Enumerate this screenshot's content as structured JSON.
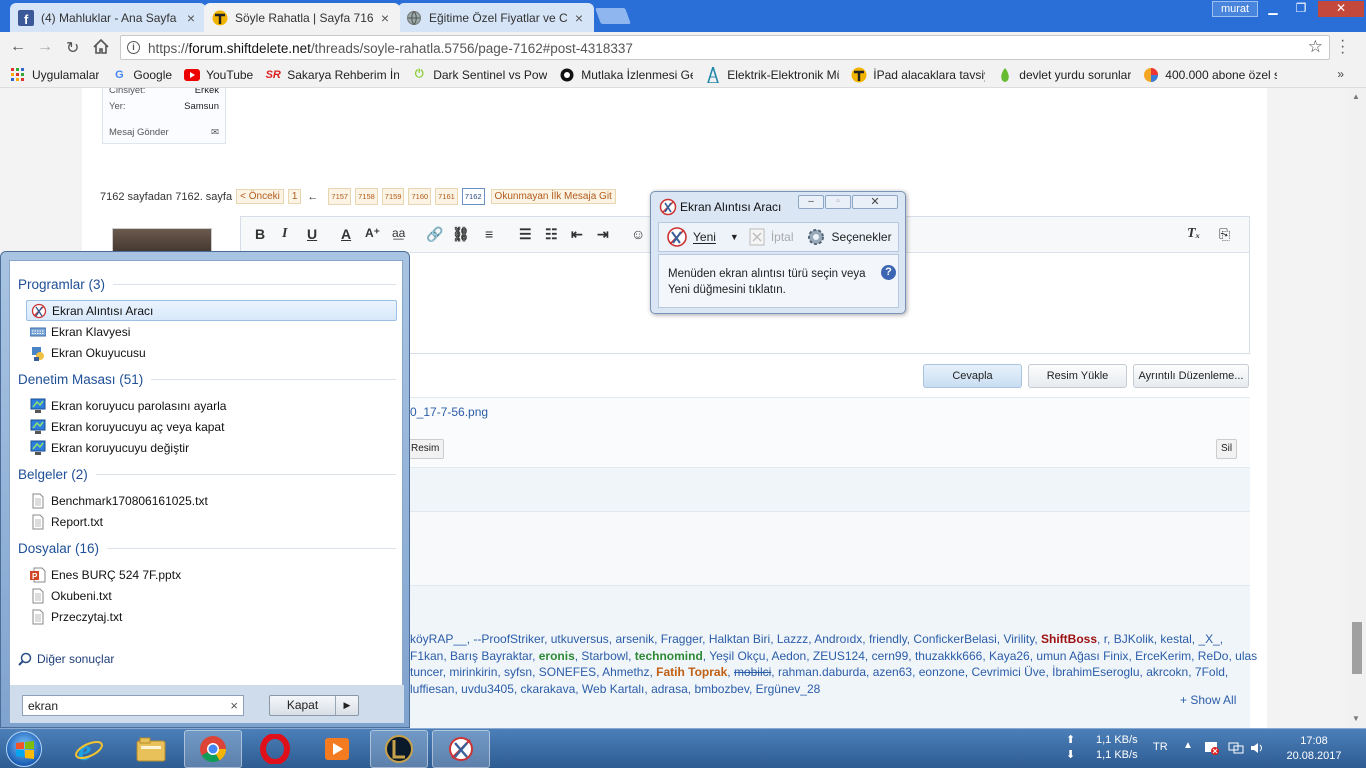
{
  "browser": {
    "tabs": [
      {
        "title": "(4) Mahluklar - Ana Sayfa",
        "icon": "facebook-icon",
        "color": "#3b5998"
      },
      {
        "title": "Söyle Rahatla | Sayfa 716",
        "icon": "shiftdelete-icon",
        "color": "#f0b400"
      },
      {
        "title": "Eğitime Özel Fiyatlar ve C",
        "icon": "globe-icon",
        "color": "#888888"
      }
    ],
    "user": "murat",
    "url_prefix": "https://",
    "url_host": "forum.shiftdelete.net",
    "url_path": "/threads/soyle-rahatla.5756/page-7162#post-4318337"
  },
  "bookmarks": [
    {
      "label": "Uygulamalar",
      "icon": "apps-grid-icon"
    },
    {
      "label": "Google",
      "icon": "google-icon"
    },
    {
      "label": "YouTube",
      "icon": "youtube-icon"
    },
    {
      "label": "Sakarya Rehberim İnç",
      "icon": "sr-logo-icon"
    },
    {
      "label": "Dark Sentinel vs Pow",
      "icon": "power-icon"
    },
    {
      "label": "Mutlaka İzlenmesi Ge",
      "icon": "chat-bubble-icon"
    },
    {
      "label": "Elektrik-Elektronik Mü",
      "icon": "tower-icon"
    },
    {
      "label": "İPad alacaklara tavsiy",
      "icon": "shiftdelete-icon"
    },
    {
      "label": "devlet yurdu sorunlar",
      "icon": "leaf-icon"
    },
    {
      "label": "400.000 abone özel s",
      "icon": "pie-icon"
    }
  ],
  "forum": {
    "userinfo": {
      "gender_label": "Cinsiyet:",
      "gender_value": "Erkek",
      "location_label": "Yer:",
      "location_value": "Samsun",
      "message": "Mesaj Gönder"
    },
    "pager": {
      "summary": "7162 sayfadan 7162. sayfa",
      "prev": "< Önceki",
      "first": "1",
      "dots": "←",
      "pages": [
        "7157",
        "7158",
        "7159",
        "7160",
        "7161"
      ],
      "current": "7162",
      "unread": "Okunmayan İlk Mesaja Git"
    },
    "buttons": {
      "reply": "Cevapla",
      "upload": "Resim Yükle",
      "advanced": "Ayrıntılı Düzenleme..."
    },
    "attachment": {
      "name": "0_17-7-56.png",
      "image_btn": "Resim",
      "delete_btn": "Sil"
    },
    "online_users": [
      {
        "n": "köyRAP__",
        "s": ""
      },
      {
        "n": "--ProofStriker",
        "s": ""
      },
      {
        "n": "utkuversus",
        "s": ""
      },
      {
        "n": "arsenik",
        "s": ""
      },
      {
        "n": "Fragger",
        "s": ""
      },
      {
        "n": "Halktan Biri",
        "s": ""
      },
      {
        "n": "Lazzz",
        "s": ""
      },
      {
        "n": "Androıdx",
        "s": ""
      },
      {
        "n": "friendly",
        "s": ""
      },
      {
        "n": "ConfickerBelasi",
        "s": ""
      },
      {
        "n": "Virility",
        "s": ""
      },
      {
        "n": "ShiftBoss",
        "s": "r"
      },
      {
        "n": "r",
        "s": ""
      },
      {
        "n": "BJKolik",
        "s": ""
      },
      {
        "n": "kestal",
        "s": ""
      },
      {
        "n": "_X_",
        "s": ""
      },
      {
        "n": "F1kan",
        "s": ""
      },
      {
        "n": "Barış Bayraktar",
        "s": ""
      },
      {
        "n": "eronis",
        "s": "g"
      },
      {
        "n": "Starbowl",
        "s": ""
      },
      {
        "n": "technomind",
        "s": "g"
      },
      {
        "n": "Yeşil Okçu",
        "s": ""
      },
      {
        "n": "Aedon",
        "s": ""
      },
      {
        "n": "ZEUS124",
        "s": ""
      },
      {
        "n": "cern99",
        "s": ""
      },
      {
        "n": "thuzakkk666",
        "s": ""
      },
      {
        "n": "Kaya26",
        "s": ""
      },
      {
        "n": "umun Ağası Finix",
        "s": ""
      },
      {
        "n": "ErceKerim",
        "s": ""
      },
      {
        "n": "ReDo",
        "s": ""
      },
      {
        "n": "ulas tuncer",
        "s": ""
      },
      {
        "n": "mirinkirin",
        "s": ""
      },
      {
        "n": "syfsn",
        "s": ""
      },
      {
        "n": "SONEFES",
        "s": ""
      },
      {
        "n": "Ahmethz",
        "s": ""
      },
      {
        "n": "Fatih Toprak",
        "s": "o"
      },
      {
        "n": "mobilci",
        "s": "x"
      },
      {
        "n": "rahman.daburda",
        "s": ""
      },
      {
        "n": "azen63",
        "s": ""
      },
      {
        "n": "eonzone",
        "s": ""
      },
      {
        "n": "Cevrimici Üve",
        "s": ""
      },
      {
        "n": "İbrahimEseroglu",
        "s": ""
      },
      {
        "n": "akrcokn",
        "s": ""
      },
      {
        "n": "7Fold",
        "s": ""
      },
      {
        "n": "luffiesan",
        "s": ""
      },
      {
        "n": "uvdu3405",
        "s": ""
      },
      {
        "n": "ckarakava",
        "s": ""
      },
      {
        "n": "Web Kartalı",
        "s": ""
      },
      {
        "n": "adrasa",
        "s": ""
      },
      {
        "n": "bmbozbev",
        "s": ""
      },
      {
        "n": "Ergünev_28",
        "s": ""
      }
    ],
    "show_all": "+ Show All"
  },
  "snipping_tool": {
    "title": "Ekran Alıntısı Aracı",
    "new": "Yeni",
    "cancel": "İptal",
    "options": "Seçenekler",
    "message": "Menüden ekran alıntısı türü seçin veya Yeni düğmesini tıklatın.",
    "help": "?"
  },
  "start_menu": {
    "categories": [
      {
        "title": "Programlar (3)",
        "items": [
          {
            "label": "Ekran Alıntısı Aracı",
            "icon": "snipping-tool-icon",
            "selected": true
          },
          {
            "label": "Ekran Klavyesi",
            "icon": "keyboard-icon"
          },
          {
            "label": "Ekran Okuyucusu",
            "icon": "narrator-icon"
          }
        ]
      },
      {
        "title": "Denetim Masası (51)",
        "items": [
          {
            "label": "Ekran koruyucu parolasını ayarla",
            "icon": "monitor-icon"
          },
          {
            "label": "Ekran koruyucuyu aç veya kapat",
            "icon": "monitor-icon"
          },
          {
            "label": "Ekran koruyucuyu değiştir",
            "icon": "monitor-icon"
          }
        ]
      },
      {
        "title": "Belgeler (2)",
        "items": [
          {
            "label": "Benchmark170806161025.txt",
            "icon": "text-file-icon"
          },
          {
            "label": "Report.txt",
            "icon": "text-file-icon"
          }
        ]
      },
      {
        "title": "Dosyalar (16)",
        "items": [
          {
            "label": "Enes BURÇ 524 7F.pptx",
            "icon": "powerpoint-icon"
          },
          {
            "label": "Okubeni.txt",
            "icon": "text-file-icon"
          },
          {
            "label": "Przeczytaj.txt",
            "icon": "text-file-icon"
          }
        ]
      }
    ],
    "more_results": "Diğer sonuçlar",
    "search_value": "ekran",
    "shutdown": "Kapat"
  },
  "taskbar": {
    "apps": [
      "internet-explorer-icon",
      "file-explorer-icon",
      "chrome-icon",
      "opera-icon",
      "media-player-icon",
      "league-of-legends-icon",
      "snipping-tool-icon"
    ],
    "upload": "1,1 KB/s",
    "download": "1,1 KB/s",
    "lang": "TR",
    "time": "17:08",
    "date": "20.08.2017"
  }
}
